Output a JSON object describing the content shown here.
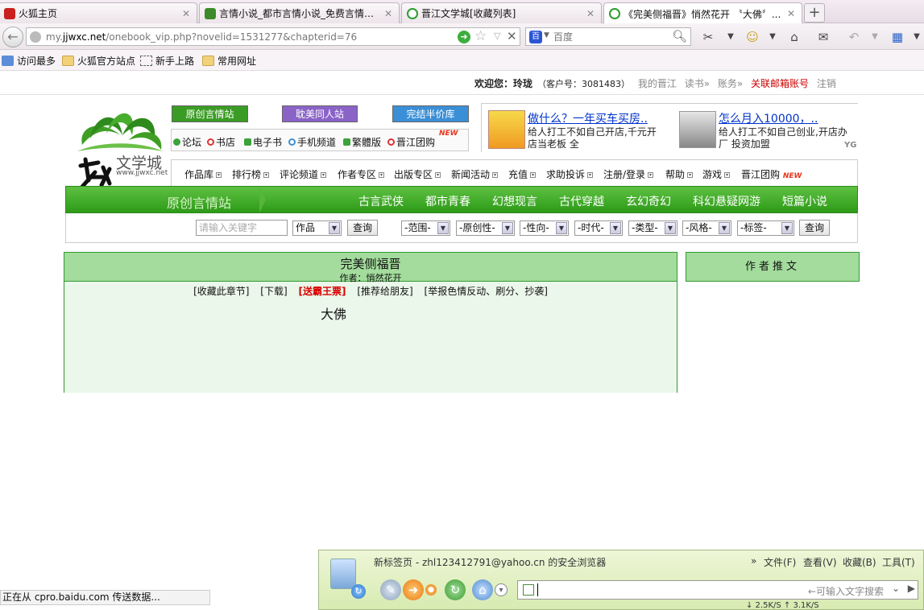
{
  "browser": {
    "tabs": [
      {
        "title": "火狐主页",
        "active": false,
        "icon_color": "#c8201e"
      },
      {
        "title": "言情小说_都市言情小说_免费言情小...",
        "active": false,
        "icon_color": "#3c8a2a"
      },
      {
        "title": "晋江文学城[收藏列表]",
        "active": false,
        "icon_color": "#2c9c2c"
      },
      {
        "title": "《完美侧福晋》悄然花开 〝大佛〞...",
        "active": true,
        "icon_color": "#2c9c2c"
      }
    ],
    "url_prefix": "my.",
    "url_domain": "jjwxc.net",
    "url_rest": "/onebook_vip.php?novelid=1531277&chapterid=76",
    "search_placeholder": "百度",
    "bookmarks": [
      "访问最多",
      "火狐官方站点",
      "新手上路",
      "常用网址"
    ]
  },
  "userbar": {
    "welcome": "欢迎您：玲珑",
    "client_id": "（客户号：3081483）",
    "links": [
      "我的晋江",
      "读书»",
      "账务»"
    ],
    "bind_email": "关联邮箱账号",
    "logout": "注销"
  },
  "logo": {
    "text_top": "文学城",
    "url": "www.jjwxc.net",
    "brand": "晋江"
  },
  "topbuttons": [
    {
      "label": "原创言情站",
      "color": "#3a9c24"
    },
    {
      "label": "耽美同人站",
      "color": "#8a63c7"
    },
    {
      "label": "完结半价库",
      "color": "#3b8fd6"
    }
  ],
  "quicklinks": [
    {
      "label": "论坛",
      "color": "#3aa33a"
    },
    {
      "label": "书店",
      "color": "#d33"
    },
    {
      "label": "电子书",
      "color": "#3aa33a"
    },
    {
      "label": "手机频道",
      "color": "#3b8fd6"
    },
    {
      "label": "繁體版",
      "color": "#3aa33a"
    },
    {
      "label": "晋江团购",
      "color": "#d33"
    }
  ],
  "new_badge": "NEW",
  "ads": [
    {
      "title": "做什么？一年买车买房..",
      "text": "给人打工不如自己开店,千元开店当老板 全"
    },
    {
      "title": "怎么月入10000，..",
      "text": "给人打工不如自己创业,开店办厂 投资加盟"
    }
  ],
  "ad_badge": "YG",
  "menu": [
    "作品库",
    "排行榜",
    "评论频道",
    "作者专区",
    "出版专区",
    "新闻活动",
    "充值",
    "求助投诉",
    "注册/登录",
    "帮助",
    "游戏",
    "晋江团购"
  ],
  "greenbar": {
    "site_name": "原创言情站",
    "categories": [
      "古言武侠",
      "都市青春",
      "幻想现言",
      "古代穿越",
      "玄幻奇幻",
      "科幻悬疑网游",
      "短篇小说"
    ]
  },
  "search": {
    "keyword_placeholder": "请输入关键字",
    "type": "作品",
    "query1": "查询",
    "filters": [
      "-范围-",
      "-原创性-",
      "-性向-",
      "-时代-",
      "-类型-",
      "-风格-",
      "-标签-"
    ],
    "query2": "查询"
  },
  "chapter": {
    "book_title": "完美侧福晋",
    "author_line": "作者：悄然花开",
    "actions": [
      "[收藏此章节]",
      "[下载]",
      "[送霸王票]",
      "[推荐给朋友]",
      "[举报色情反动、刷分、抄袭]"
    ],
    "chapter_title": "大佛"
  },
  "author_recommend": "作者推文",
  "status": "正在从 cpro.baidu.com 传送数据...",
  "overlay": {
    "title": "新标签页 - zhl123412791@yahoo.cn 的安全浏览器",
    "menu": [
      "»",
      "文件(F)",
      "查看(V)",
      "收藏(B)",
      "工具(T)"
    ],
    "search_placeholder": "←可输入文字搜索",
    "speed": "↓ 2.5K/S ↑ 3.1K/S"
  }
}
